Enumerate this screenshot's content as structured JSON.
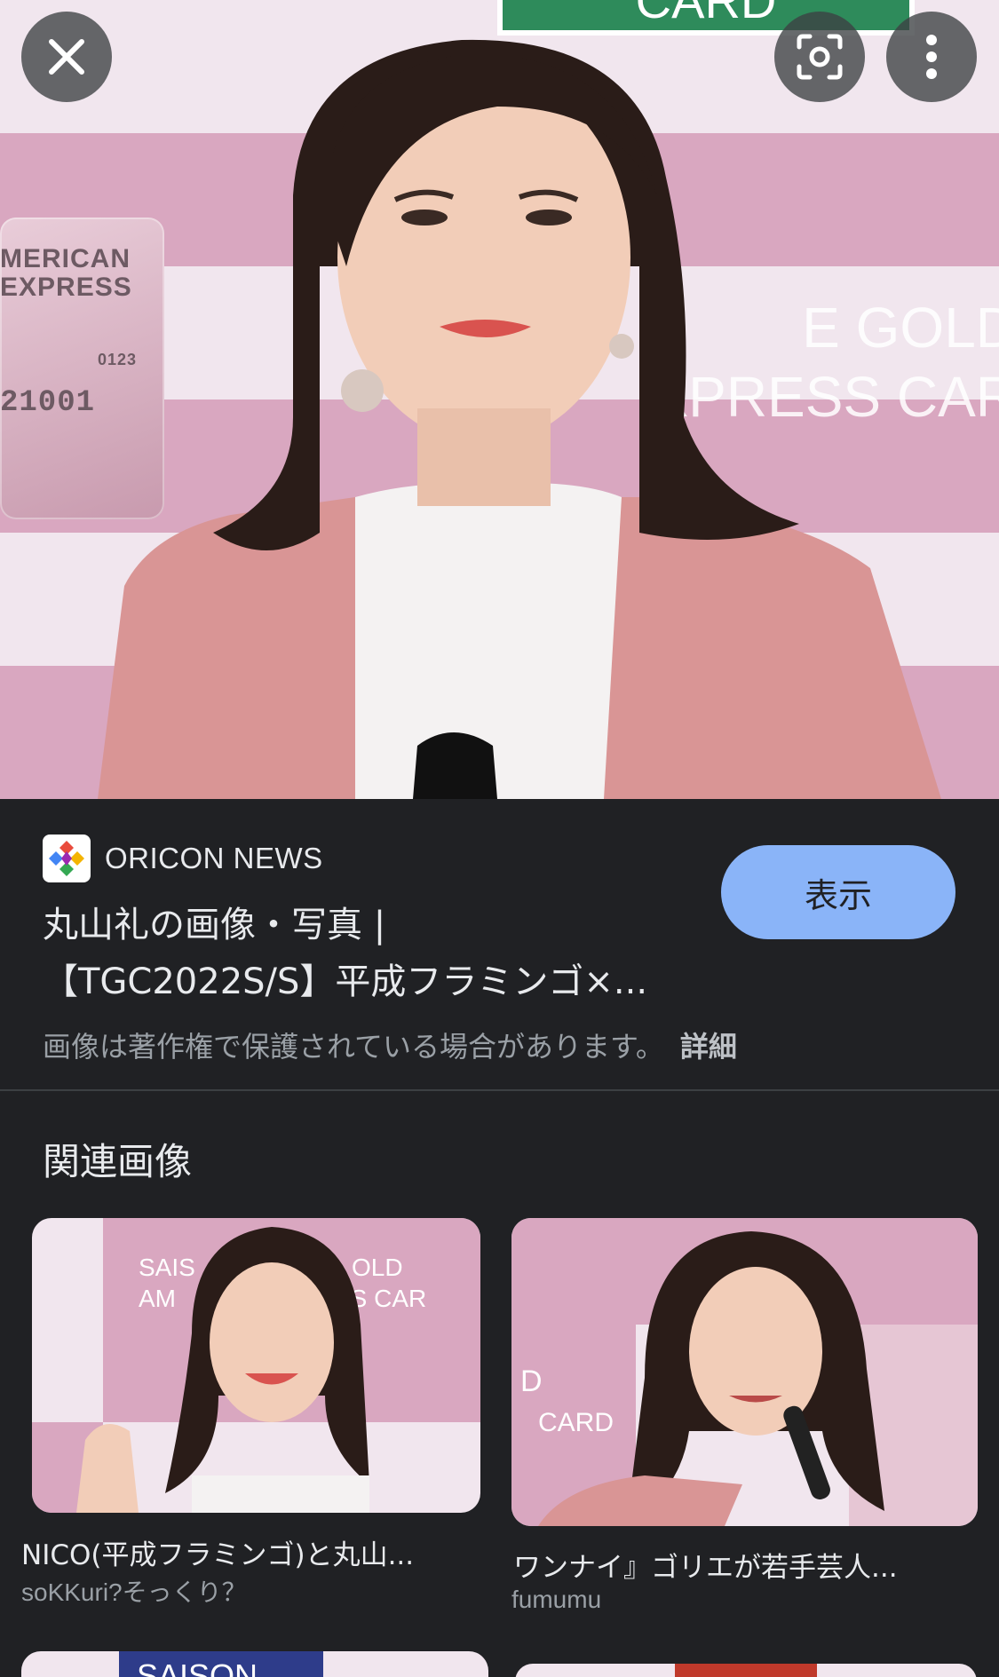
{
  "hero": {
    "top_card_text": "CARD",
    "card_left_lines": [
      "MERICAN",
      "EXPRESS",
      "0123",
      "21001"
    ],
    "backdrop_text_lines": [
      "E GOLD",
      "XPRESS CAR"
    ],
    "close_icon": "close-icon",
    "lens_icon": "lens-icon",
    "more_icon": "more-vertical-icon"
  },
  "result": {
    "source": "ORICON NEWS",
    "title_line1": "丸山礼の画像・写真 |",
    "title_line2": "【TGC2022S/S】平成フラミンゴ×...",
    "view_button": "表示",
    "copyright_notice": "画像は著作権で保護されている場合があります。",
    "details_link": "詳細"
  },
  "related": {
    "heading": "関連画像",
    "items": [
      {
        "title": "NICO(平成フラミンゴ)と丸山...",
        "source": "soKKuri?そっくり？",
        "image_text": [
          "SAIS",
          "AM",
          "OLD",
          "SS CAR"
        ]
      },
      {
        "title": "ワンナイ』ゴリエが若手芸人...",
        "source": "fumumu",
        "image_text": [
          "D",
          "CARD"
        ]
      },
      {
        "title": "",
        "source": "",
        "image_text": [
          "SAISON"
        ]
      }
    ]
  },
  "colors": {
    "background": "#202124",
    "button": "#8ab4f8",
    "pink": "#d9a7c0"
  }
}
